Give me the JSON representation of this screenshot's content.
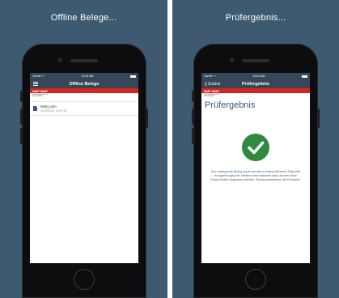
{
  "left": {
    "caption": "Offline Belege...",
    "status": {
      "carrier": "Carrier ᯤ",
      "time": "10:34 AM"
    },
    "nav_title": "Offline Belege",
    "brand": "BMF BMF",
    "brand_sub": [
      "BUNDESMINISTERIUM",
      "DER FINANZEN"
    ],
    "list_items": [
      {
        "title": "Beleg vom",
        "date": "30.03.2023, 10:47:28"
      }
    ]
  },
  "right": {
    "caption": "Prüfergebnis...",
    "status": {
      "carrier": "Carrier ᯤ",
      "time": "10:34 AM"
    },
    "back_label": "Zurück",
    "nav_title": "Prüfergebnis",
    "brand": "BMF BMF",
    "brand_sub": [
      "BUNDESMINISTERIUM",
      "DER FINANZEN"
    ],
    "heading": "Prüfergebnis",
    "message": "Der vorliegende Beleg wurde bereits zu einem früheren Zeitpunkt erfolgreich geprüft. Weitere Informationen dazu können über FinanzOnline abgerufen werden. Bundesministerium für Finanzen.",
    "success_color": "#2e8b3e"
  },
  "colors": {
    "background": "#3d5a70",
    "navbar": "#37475a",
    "brand_red": "#d6251e",
    "heading_blue": "#3b5877"
  },
  "icons": [
    "menu-icon",
    "document-icon",
    "back-chevron-icon",
    "checkmark-icon",
    "battery-icon"
  ]
}
